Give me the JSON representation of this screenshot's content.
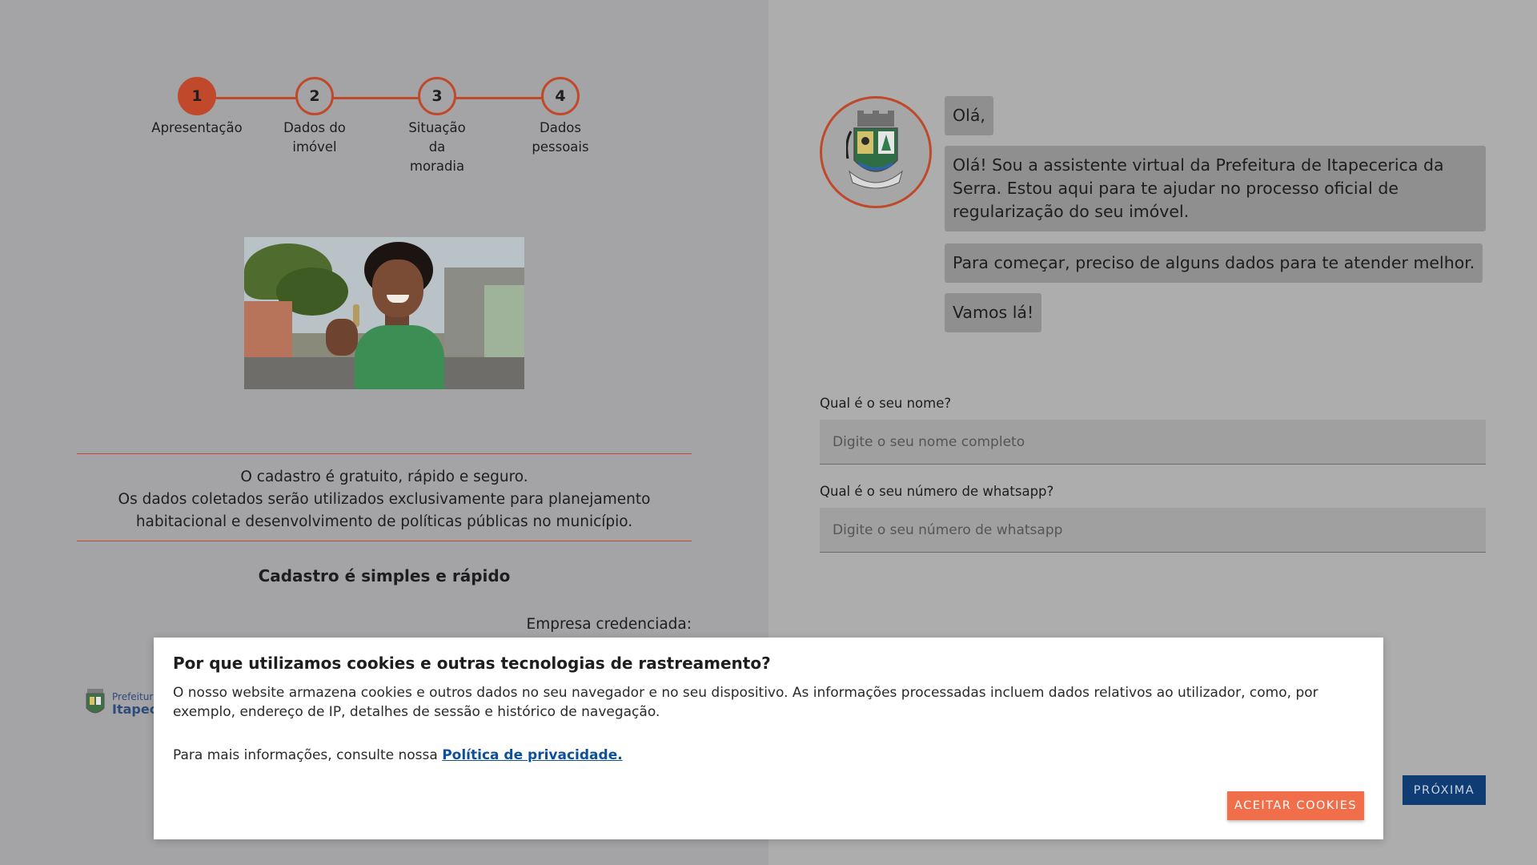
{
  "steps": [
    {
      "number": "1",
      "label": "Apresentação"
    },
    {
      "number": "2",
      "label": "Dados do imóvel"
    },
    {
      "number": "3",
      "label": "Situação da moradia"
    },
    {
      "number": "4",
      "label": "Dados pessoais"
    }
  ],
  "info": {
    "line1": "O cadastro é gratuito, rápido e seguro.",
    "line2": "Os dados coletados serão utilizados exclusivamente para planejamento habitacional e desenvolvimento de políticas públicas no município.",
    "title": "Cadastro é simples e rápido",
    "company_label": "Empresa credenciada:"
  },
  "footer_logo": {
    "line1": "Prefeitura",
    "line2": "Itapec"
  },
  "chat": {
    "messages": [
      "Olá,",
      "Olá! Sou a assistente virtual da Prefeitura de Itapecerica da Serra. Estou aqui para te ajudar no processo oficial de regularização do seu imóvel.",
      "Para começar, preciso de alguns dados para te atender melhor.",
      "Vamos lá!"
    ]
  },
  "form": {
    "name_label": "Qual é o seu nome?",
    "name_placeholder": "Digite o seu nome completo",
    "whatsapp_label": "Qual é o seu número de whatsapp?",
    "whatsapp_placeholder": "Digite o seu número de whatsapp"
  },
  "next_label": "PRÓXIMA",
  "cookie": {
    "title": "Por que utilizamos cookies e outras tecnologias de rastreamento?",
    "text": "O nosso website armazena cookies e outros dados no seu navegador e no seu dispositivo. As informações processadas incluem dados relativos ao utilizador, como, por exemplo, endereço de IP, detalhes de sessão e histórico de navegação.",
    "more_prefix": "Para mais informações, consulte nossa",
    "privacy_link": "Política de privacidade.",
    "accept_label": "ACEITAR COOKIES"
  },
  "colors": {
    "accent": "#c0492b",
    "primary_button": "#0e3c73",
    "cookie_button": "#f06e4a",
    "link": "#0e4f9c"
  }
}
